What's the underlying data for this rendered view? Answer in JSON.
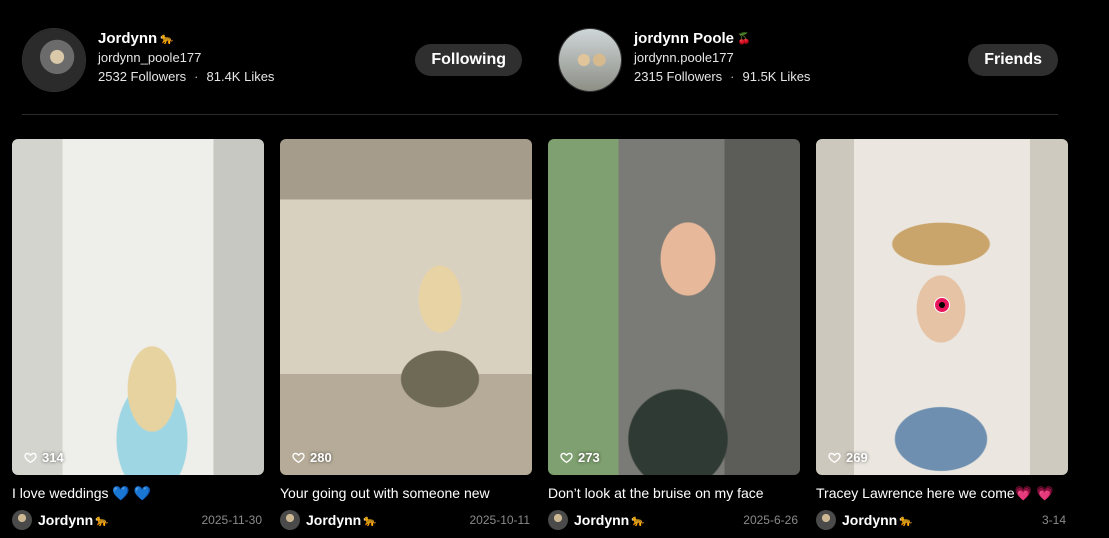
{
  "accounts": [
    {
      "name": "Jordynn",
      "name_emoji": "🐆",
      "handle": "jordynn_poole177",
      "followers": "2532 Followers",
      "likes": "81.4K Likes",
      "action": "Following"
    },
    {
      "name": "jordynn Poole",
      "name_emoji": "🍒",
      "handle": "jordynn.poole177",
      "followers": "2315 Followers",
      "likes": "91.5K Likes",
      "action": "Friends"
    }
  ],
  "stats_separator": "·",
  "videos": [
    {
      "likes": "314",
      "caption": "I love weddings 💙 💙",
      "author": "Jordynn",
      "author_emoji": "🐆",
      "date": "2025-11-30"
    },
    {
      "likes": "280",
      "caption": "Your going out with someone new",
      "author": "Jordynn",
      "author_emoji": "🐆",
      "date": "2025-10-11"
    },
    {
      "likes": "273",
      "caption": "Don’t look at the bruise on my face",
      "author": "Jordynn",
      "author_emoji": "🐆",
      "date": "2025-6-26"
    },
    {
      "likes": "269",
      "caption": "Tracey Lawrence here we come💗 💗",
      "author": "Jordynn",
      "author_emoji": "🐆",
      "date": "3-14"
    }
  ],
  "colors": {
    "background": "#000000",
    "pill": "#2f2f2f",
    "muted": "#8a8a8a",
    "record": "#e8175d"
  }
}
